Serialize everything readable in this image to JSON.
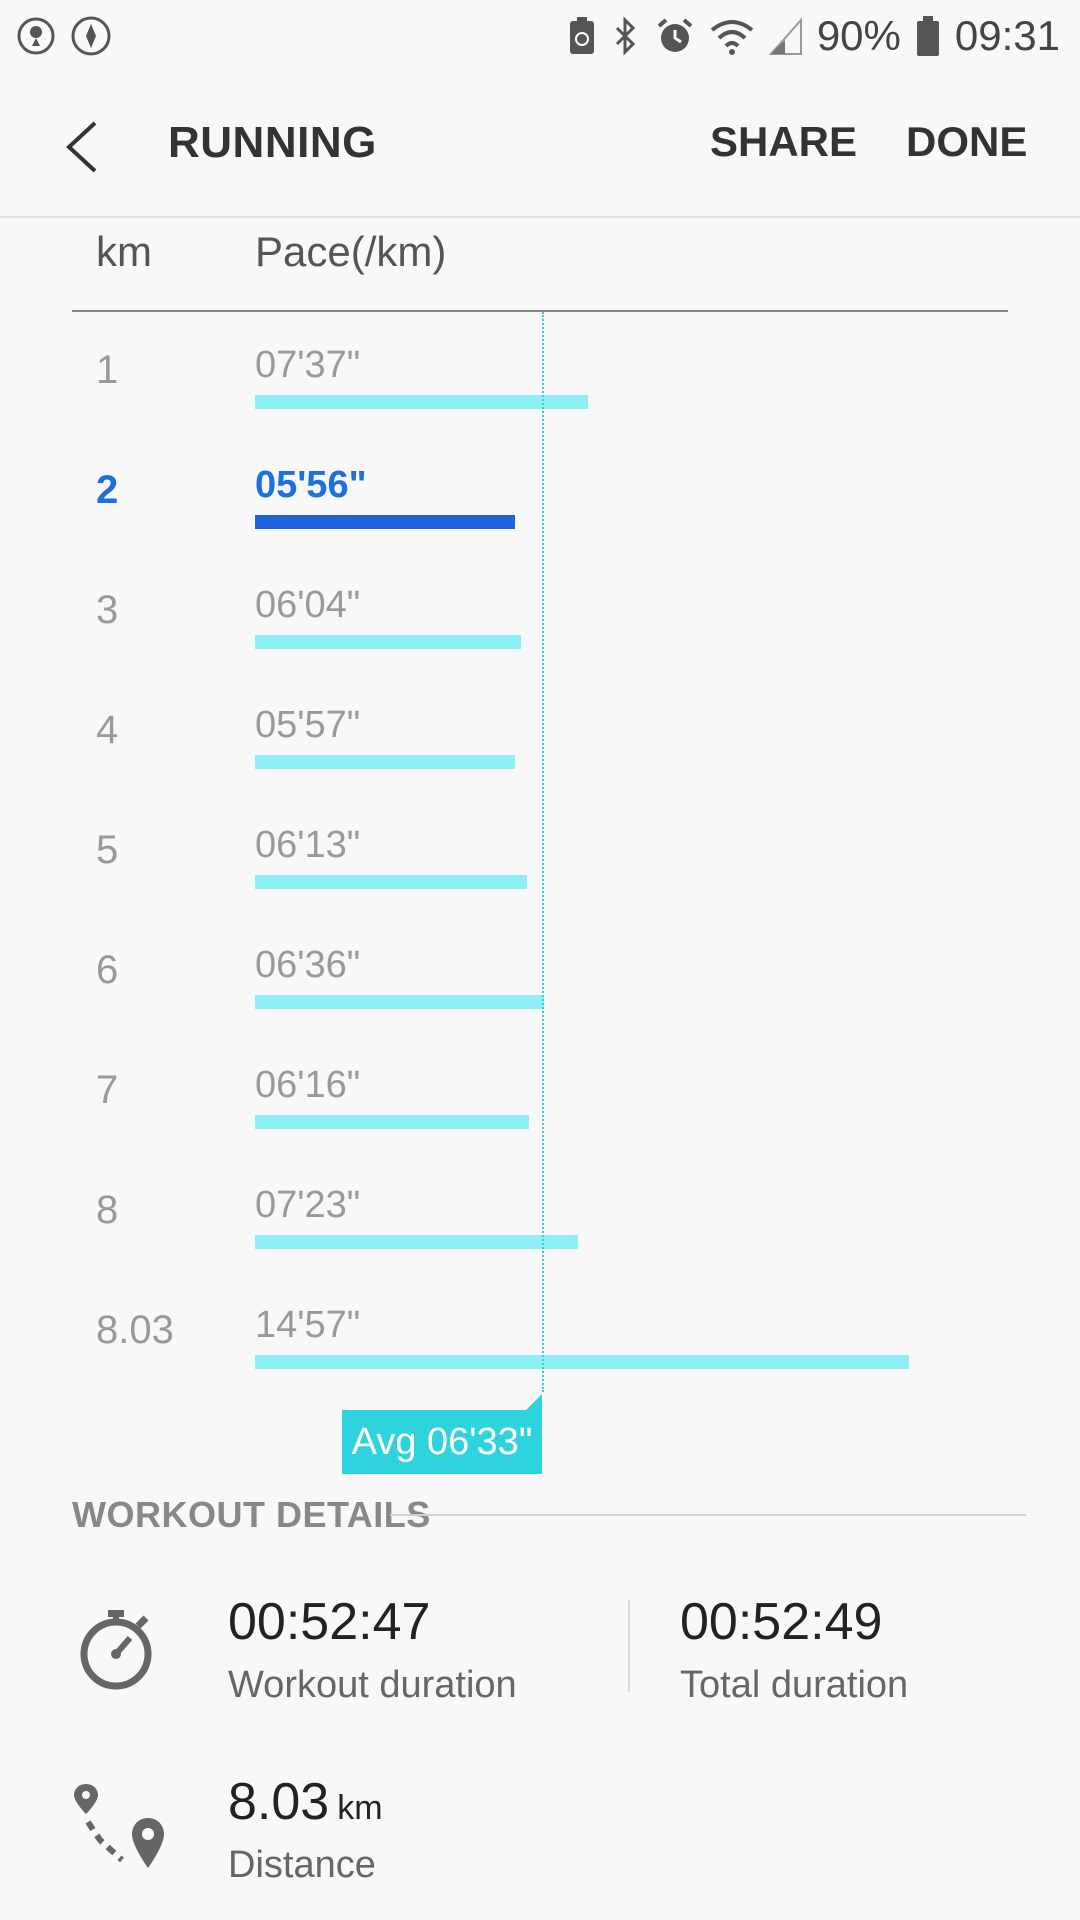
{
  "status_bar": {
    "battery_percent": "90%",
    "time": "09:31",
    "left_icons": [
      "location-pin-icon",
      "compass-icon"
    ],
    "right_icons": [
      "battery-saver-icon",
      "bluetooth-icon",
      "alarm-icon",
      "wifi-icon",
      "signal-icon",
      "battery-icon"
    ]
  },
  "app_bar": {
    "title": "RUNNING",
    "share_label": "SHARE",
    "done_label": "DONE"
  },
  "table_header": {
    "km_label": "km",
    "pace_label": "Pace(/km)"
  },
  "chart_data": {
    "type": "bar",
    "orientation": "horizontal",
    "categories": [
      "1",
      "2",
      "3",
      "4",
      "5",
      "6",
      "7",
      "8",
      "8.03"
    ],
    "pace_labels": [
      "07'37\"",
      "05'56\"",
      "06'04\"",
      "05'57\"",
      "06'13\"",
      "06'36\"",
      "06'16\"",
      "07'23\"",
      "14'57\""
    ],
    "values_seconds": [
      457,
      356,
      364,
      357,
      373,
      396,
      376,
      443,
      897
    ],
    "selected_index": 1,
    "average_label": "Avg 06'33\"",
    "average_seconds": 393,
    "colors": {
      "bar": "#8ef0f4",
      "selected_bar": "#1e63e0",
      "selected_text": "#1e6fe0",
      "average": "#2fd3dd"
    }
  },
  "workout_details": {
    "title": "WORKOUT DETAILS",
    "workout_duration_value": "00:52:47",
    "workout_duration_label": "Workout duration",
    "total_duration_value": "00:52:49",
    "total_duration_label": "Total duration",
    "distance_value": "8.03",
    "distance_unit": "km",
    "distance_label": "Distance"
  }
}
